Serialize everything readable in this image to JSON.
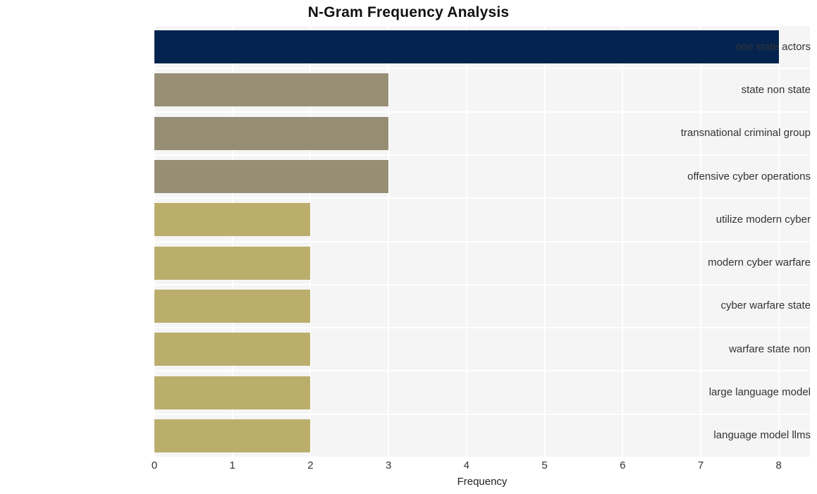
{
  "chart_data": {
    "type": "bar",
    "orientation": "horizontal",
    "title": "N-Gram Frequency Analysis",
    "xlabel": "Frequency",
    "ylabel": "",
    "categories": [
      "non state actors",
      "state non state",
      "transnational criminal group",
      "offensive cyber operations",
      "utilize modern cyber",
      "modern cyber warfare",
      "cyber warfare state",
      "warfare state non",
      "large language model",
      "language model llms"
    ],
    "values": [
      8,
      3,
      3,
      3,
      2,
      2,
      2,
      2,
      2,
      2
    ],
    "bar_colors": [
      "#04244f",
      "#988f76",
      "#968d75",
      "#978e76",
      "#bbae6d",
      "#bbae6d",
      "#bbae6d",
      "#bbae6d",
      "#bbae6d",
      "#bbae6d"
    ],
    "xlim": [
      0,
      8.4
    ],
    "xticks": [
      0,
      1,
      2,
      3,
      4,
      5,
      6,
      7,
      8
    ],
    "xtick_labels": [
      "0",
      "1",
      "2",
      "3",
      "4",
      "5",
      "6",
      "7",
      "8"
    ],
    "grid": true,
    "grid_color": "#ffffff",
    "plot_background": "#f5f5f6",
    "figure_background": "#ffffff",
    "legend": null
  }
}
